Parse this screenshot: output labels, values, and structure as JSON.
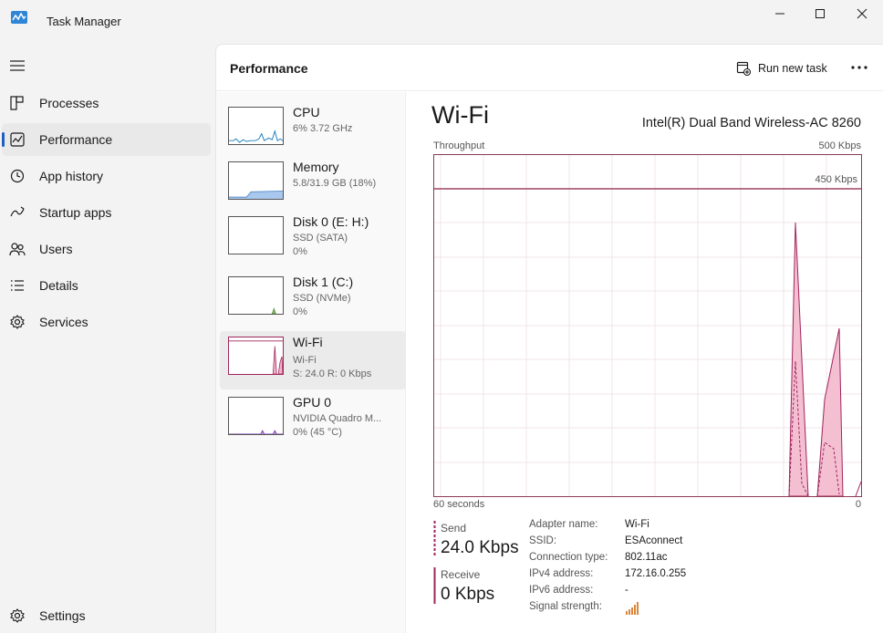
{
  "app": {
    "title": "Task Manager"
  },
  "sidebar": {
    "items": [
      {
        "label": "Processes",
        "icon": "processes-icon"
      },
      {
        "label": "Performance",
        "icon": "performance-icon"
      },
      {
        "label": "App history",
        "icon": "app-history-icon"
      },
      {
        "label": "Startup apps",
        "icon": "startup-apps-icon"
      },
      {
        "label": "Users",
        "icon": "users-icon"
      },
      {
        "label": "Details",
        "icon": "details-icon"
      },
      {
        "label": "Services",
        "icon": "services-icon"
      }
    ],
    "active": "Performance",
    "settings_label": "Settings"
  },
  "header": {
    "title": "Performance",
    "run_new_task": "Run new task",
    "more": "..."
  },
  "resources": [
    {
      "name": "CPU",
      "line1": "6% 3.72 GHz",
      "line2": "",
      "color": "#1b7fbd"
    },
    {
      "name": "Memory",
      "line1": "5.8/31.9 GB (18%)",
      "line2": "",
      "color": "#5b8fc9"
    },
    {
      "name": "Disk 0 (E: H:)",
      "line1": "SSD (SATA)",
      "line2": "0%",
      "color": "#4f8a2c"
    },
    {
      "name": "Disk 1 (C:)",
      "line1": "SSD (NVMe)",
      "line2": "0%",
      "color": "#4f8a2c"
    },
    {
      "name": "Wi-Fi",
      "line1": "Wi-Fi",
      "line2": "S: 24.0 R: 0 Kbps",
      "color": "#a0245c"
    },
    {
      "name": "GPU 0",
      "line1": "NVIDIA Quadro M...",
      "line2": "0% (45 °C)",
      "color": "#7d3bb5"
    }
  ],
  "detail": {
    "title": "Wi-Fi",
    "adapter_model": "Intel(R) Dual Band Wireless-AC 8260",
    "graph_label": "Throughput",
    "graph_max": "500 Kbps",
    "graph_line_label": "450 Kbps",
    "x_left": "60 seconds",
    "x_right": "0",
    "accent": "#a0245c",
    "send": {
      "label": "Send",
      "value": "24.0 Kbps"
    },
    "receive": {
      "label": "Receive",
      "value": "0 Kbps"
    },
    "properties": [
      {
        "key": "Adapter name:",
        "value": "Wi-Fi"
      },
      {
        "key": "SSID:",
        "value": "ESAconnect"
      },
      {
        "key": "Connection type:",
        "value": "802.11ac"
      },
      {
        "key": "IPv4 address:",
        "value": "172.16.0.255"
      },
      {
        "key": "IPv6 address:",
        "value": "-"
      },
      {
        "key": "Signal strength:",
        "value": ""
      }
    ]
  }
}
